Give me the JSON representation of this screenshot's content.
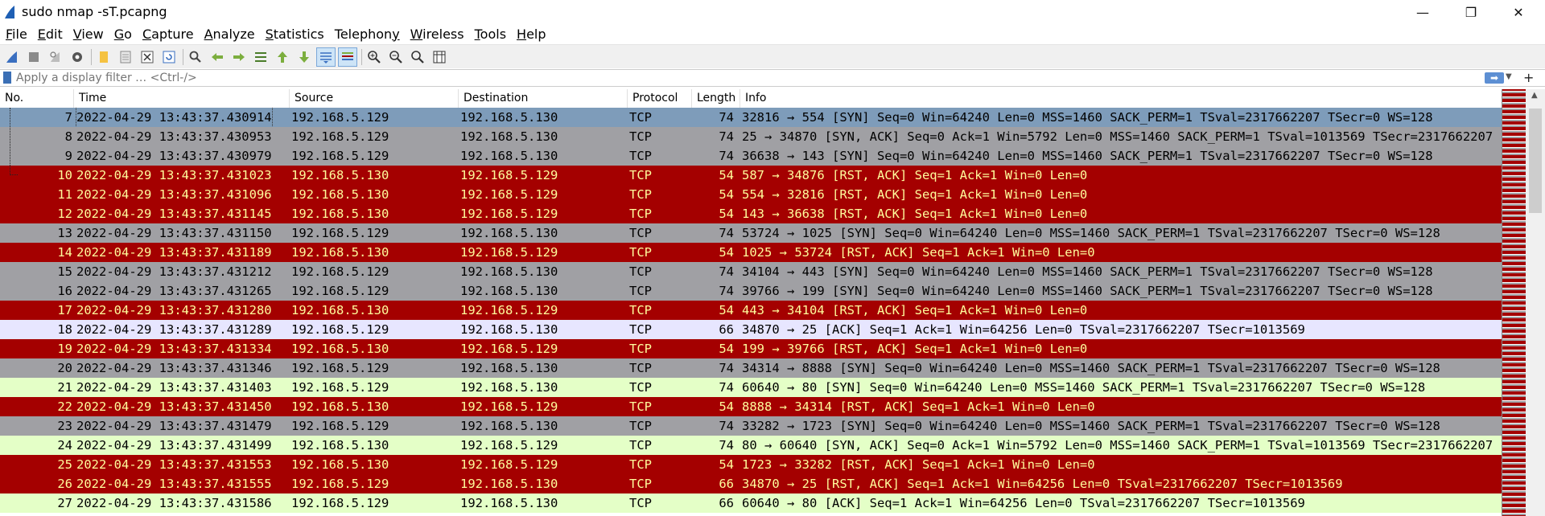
{
  "window": {
    "title": "sudo nmap -sT.pcapng",
    "minimize": "—",
    "maximize": "❐",
    "close": "✕"
  },
  "menu": [
    {
      "label": "File",
      "mnemonic": "F"
    },
    {
      "label": "Edit",
      "mnemonic": "E"
    },
    {
      "label": "View",
      "mnemonic": "V"
    },
    {
      "label": "Go",
      "mnemonic": "G"
    },
    {
      "label": "Capture",
      "mnemonic": "C"
    },
    {
      "label": "Analyze",
      "mnemonic": "A"
    },
    {
      "label": "Statistics",
      "mnemonic": "S"
    },
    {
      "label": "Telephony",
      "mnemonic": "y"
    },
    {
      "label": "Wireless",
      "mnemonic": "W"
    },
    {
      "label": "Tools",
      "mnemonic": "T"
    },
    {
      "label": "Help",
      "mnemonic": "H"
    }
  ],
  "toolbar_icons": [
    "shark-fin-start-icon",
    "stop-square-icon",
    "restart-fin-icon",
    "capture-options-gear-icon",
    "open-folder-icon",
    "save-file-icon",
    "close-file-icon",
    "reload-icon",
    "find-packet-icon",
    "go-back-arrow-icon",
    "go-forward-arrow-icon",
    "go-to-packet-icon",
    "go-first-packet-icon",
    "go-last-packet-icon",
    "autoscroll-icon",
    "colorize-icon",
    "zoom-in-icon",
    "zoom-out-icon",
    "normal-size-icon",
    "resize-columns-icon"
  ],
  "filter": {
    "placeholder": "Apply a display filter … <Ctrl-/>",
    "value": "",
    "apply_label": "➡",
    "add_label": "+"
  },
  "columns": [
    "No.",
    "Time",
    "Source",
    "Destination",
    "Protocol",
    "Length",
    "Info"
  ],
  "colors": {
    "selected": "#7e9cba",
    "gray": "#a0a0a4",
    "rst_red": "#a40000",
    "rst_text": "#fffc9c",
    "lavender": "#e7e6ff",
    "green": "#e4ffc7"
  },
  "packets": [
    {
      "no": "7",
      "time": "2022-04-29 13:43:37.430914",
      "src": "192.168.5.129",
      "dst": "192.168.5.130",
      "proto": "TCP",
      "len": "74",
      "info": "32816 → 554 [SYN] Seq=0 Win=64240 Len=0 MSS=1460 SACK_PERM=1 TSval=2317662207 TSecr=0 WS=128",
      "style": "sel"
    },
    {
      "no": "8",
      "time": "2022-04-29 13:43:37.430953",
      "src": "192.168.5.129",
      "dst": "192.168.5.130",
      "proto": "TCP",
      "len": "74",
      "info": "25 → 34870 [SYN, ACK] Seq=0 Ack=1 Win=5792 Len=0 MSS=1460 SACK_PERM=1 TSval=1013569 TSecr=2317662207",
      "style": "gray"
    },
    {
      "no": "9",
      "time": "2022-04-29 13:43:37.430979",
      "src": "192.168.5.129",
      "dst": "192.168.5.130",
      "proto": "TCP",
      "len": "74",
      "info": "36638 → 143 [SYN] Seq=0 Win=64240 Len=0 MSS=1460 SACK_PERM=1 TSval=2317662207 TSecr=0 WS=128",
      "style": "gray"
    },
    {
      "no": "10",
      "time": "2022-04-29 13:43:37.431023",
      "src": "192.168.5.130",
      "dst": "192.168.5.129",
      "proto": "TCP",
      "len": "54",
      "info": "587 → 34876 [RST, ACK] Seq=1 Ack=1 Win=0 Len=0",
      "style": "red"
    },
    {
      "no": "11",
      "time": "2022-04-29 13:43:37.431096",
      "src": "192.168.5.130",
      "dst": "192.168.5.129",
      "proto": "TCP",
      "len": "54",
      "info": "554 → 32816 [RST, ACK] Seq=1 Ack=1 Win=0 Len=0",
      "style": "red"
    },
    {
      "no": "12",
      "time": "2022-04-29 13:43:37.431145",
      "src": "192.168.5.130",
      "dst": "192.168.5.129",
      "proto": "TCP",
      "len": "54",
      "info": "143 → 36638 [RST, ACK] Seq=1 Ack=1 Win=0 Len=0",
      "style": "red"
    },
    {
      "no": "13",
      "time": "2022-04-29 13:43:37.431150",
      "src": "192.168.5.129",
      "dst": "192.168.5.130",
      "proto": "TCP",
      "len": "74",
      "info": "53724 → 1025 [SYN] Seq=0 Win=64240 Len=0 MSS=1460 SACK_PERM=1 TSval=2317662207 TSecr=0 WS=128",
      "style": "gray"
    },
    {
      "no": "14",
      "time": "2022-04-29 13:43:37.431189",
      "src": "192.168.5.130",
      "dst": "192.168.5.129",
      "proto": "TCP",
      "len": "54",
      "info": "1025 → 53724 [RST, ACK] Seq=1 Ack=1 Win=0 Len=0",
      "style": "red"
    },
    {
      "no": "15",
      "time": "2022-04-29 13:43:37.431212",
      "src": "192.168.5.129",
      "dst": "192.168.5.130",
      "proto": "TCP",
      "len": "74",
      "info": "34104 → 443 [SYN] Seq=0 Win=64240 Len=0 MSS=1460 SACK_PERM=1 TSval=2317662207 TSecr=0 WS=128",
      "style": "gray"
    },
    {
      "no": "16",
      "time": "2022-04-29 13:43:37.431265",
      "src": "192.168.5.129",
      "dst": "192.168.5.130",
      "proto": "TCP",
      "len": "74",
      "info": "39766 → 199 [SYN] Seq=0 Win=64240 Len=0 MSS=1460 SACK_PERM=1 TSval=2317662207 TSecr=0 WS=128",
      "style": "gray"
    },
    {
      "no": "17",
      "time": "2022-04-29 13:43:37.431280",
      "src": "192.168.5.130",
      "dst": "192.168.5.129",
      "proto": "TCP",
      "len": "54",
      "info": "443 → 34104 [RST, ACK] Seq=1 Ack=1 Win=0 Len=0",
      "style": "red"
    },
    {
      "no": "18",
      "time": "2022-04-29 13:43:37.431289",
      "src": "192.168.5.129",
      "dst": "192.168.5.130",
      "proto": "TCP",
      "len": "66",
      "info": "34870 → 25 [ACK] Seq=1 Ack=1 Win=64256 Len=0 TSval=2317662207 TSecr=1013569",
      "style": "lav"
    },
    {
      "no": "19",
      "time": "2022-04-29 13:43:37.431334",
      "src": "192.168.5.130",
      "dst": "192.168.5.129",
      "proto": "TCP",
      "len": "54",
      "info": "199 → 39766 [RST, ACK] Seq=1 Ack=1 Win=0 Len=0",
      "style": "red"
    },
    {
      "no": "20",
      "time": "2022-04-29 13:43:37.431346",
      "src": "192.168.5.129",
      "dst": "192.168.5.130",
      "proto": "TCP",
      "len": "74",
      "info": "34314 → 8888 [SYN] Seq=0 Win=64240 Len=0 MSS=1460 SACK_PERM=1 TSval=2317662207 TSecr=0 WS=128",
      "style": "gray"
    },
    {
      "no": "21",
      "time": "2022-04-29 13:43:37.431403",
      "src": "192.168.5.129",
      "dst": "192.168.5.130",
      "proto": "TCP",
      "len": "74",
      "info": "60640 → 80 [SYN] Seq=0 Win=64240 Len=0 MSS=1460 SACK_PERM=1 TSval=2317662207 TSecr=0 WS=128",
      "style": "grn"
    },
    {
      "no": "22",
      "time": "2022-04-29 13:43:37.431450",
      "src": "192.168.5.130",
      "dst": "192.168.5.129",
      "proto": "TCP",
      "len": "54",
      "info": "8888 → 34314 [RST, ACK] Seq=1 Ack=1 Win=0 Len=0",
      "style": "red"
    },
    {
      "no": "23",
      "time": "2022-04-29 13:43:37.431479",
      "src": "192.168.5.129",
      "dst": "192.168.5.130",
      "proto": "TCP",
      "len": "74",
      "info": "33282 → 1723 [SYN] Seq=0 Win=64240 Len=0 MSS=1460 SACK_PERM=1 TSval=2317662207 TSecr=0 WS=128",
      "style": "gray"
    },
    {
      "no": "24",
      "time": "2022-04-29 13:43:37.431499",
      "src": "192.168.5.130",
      "dst": "192.168.5.129",
      "proto": "TCP",
      "len": "74",
      "info": "80 → 60640 [SYN, ACK] Seq=0 Ack=1 Win=5792 Len=0 MSS=1460 SACK_PERM=1 TSval=1013569 TSecr=2317662207",
      "style": "grn"
    },
    {
      "no": "25",
      "time": "2022-04-29 13:43:37.431553",
      "src": "192.168.5.130",
      "dst": "192.168.5.129",
      "proto": "TCP",
      "len": "54",
      "info": "1723 → 33282 [RST, ACK] Seq=1 Ack=1 Win=0 Len=0",
      "style": "red"
    },
    {
      "no": "26",
      "time": "2022-04-29 13:43:37.431555",
      "src": "192.168.5.129",
      "dst": "192.168.5.130",
      "proto": "TCP",
      "len": "66",
      "info": "34870 → 25 [RST, ACK] Seq=1 Ack=1 Win=64256 Len=0 TSval=2317662207 TSecr=1013569",
      "style": "red"
    },
    {
      "no": "27",
      "time": "2022-04-29 13:43:37.431586",
      "src": "192.168.5.129",
      "dst": "192.168.5.130",
      "proto": "TCP",
      "len": "66",
      "info": "60640 → 80 [ACK] Seq=1 Ack=1 Win=64256 Len=0 TSval=2317662207 TSecr=1013569",
      "style": "grn"
    }
  ]
}
